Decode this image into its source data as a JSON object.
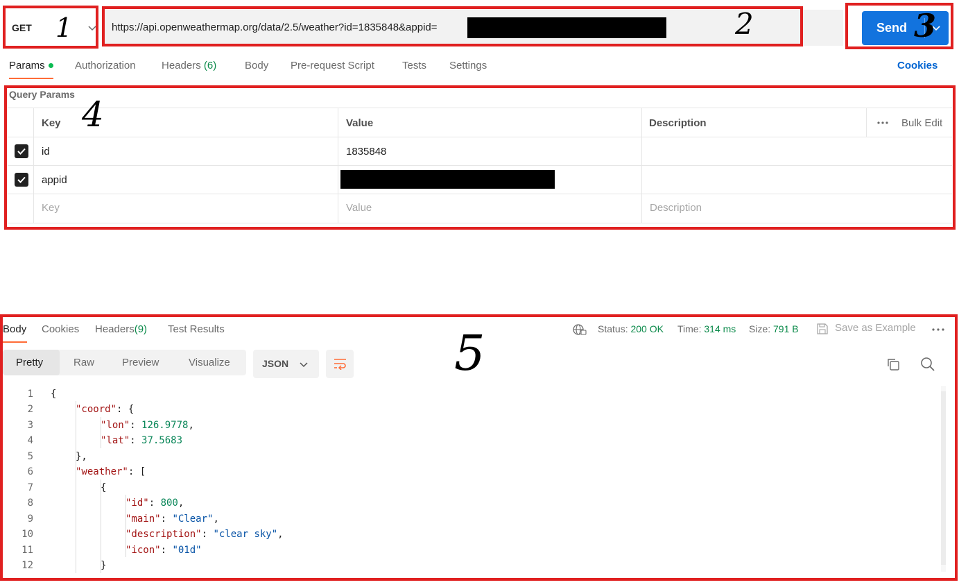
{
  "request": {
    "method": "GET",
    "url": "https://api.openweathermap.org/data/2.5/weather?id=1835848&appid=",
    "send_label": "Send"
  },
  "request_tabs": [
    {
      "label": "Params",
      "active": true
    },
    {
      "label": "Authorization"
    },
    {
      "label": "Headers",
      "count": "(6)"
    },
    {
      "label": "Body"
    },
    {
      "label": "Pre-request Script"
    },
    {
      "label": "Tests"
    },
    {
      "label": "Settings"
    }
  ],
  "cookies_link": "Cookies",
  "params": {
    "title": "Query Params",
    "headers": {
      "key": "Key",
      "value": "Value",
      "description": "Description",
      "bulk_edit": "Bulk Edit"
    },
    "rows": [
      {
        "checked": true,
        "key": "id",
        "value": "1835848"
      },
      {
        "checked": true,
        "key": "appid",
        "value": ""
      }
    ],
    "placeholders": {
      "key": "Key",
      "value": "Value",
      "description": "Description"
    }
  },
  "response": {
    "tabs": [
      {
        "label": "Body",
        "active": true
      },
      {
        "label": "Cookies"
      },
      {
        "label": "Headers",
        "count": "(9)"
      },
      {
        "label": "Test Results"
      }
    ],
    "status_label": "Status:",
    "status_value": "200 OK",
    "time_label": "Time:",
    "time_value": "314 ms",
    "size_label": "Size:",
    "size_value": "791 B",
    "save_as_example": "Save as Example",
    "view_modes": [
      "Pretty",
      "Raw",
      "Preview",
      "Visualize"
    ],
    "format": "JSON",
    "line_numbers": [
      "1",
      "2",
      "3",
      "4",
      "5",
      "6",
      "7",
      "8",
      "9",
      "10",
      "11",
      "12"
    ],
    "code": {
      "l1": "{",
      "l2_key": "\"coord\"",
      "l2_rest": ": {",
      "l3_key": "\"lon\"",
      "l3_sep": ": ",
      "l3_val": "126.9778",
      "l3_end": ",",
      "l4_key": "\"lat\"",
      "l4_sep": ": ",
      "l4_val": "37.5683",
      "l5": "},",
      "l6_key": "\"weather\"",
      "l6_rest": ": [",
      "l7": "{",
      "l8_key": "\"id\"",
      "l8_sep": ": ",
      "l8_val": "800",
      "l8_end": ",",
      "l9_key": "\"main\"",
      "l9_sep": ": ",
      "l9_val": "\"Clear\"",
      "l9_end": ",",
      "l10_key": "\"description\"",
      "l10_sep": ": ",
      "l10_val": "\"clear sky\"",
      "l10_end": ",",
      "l11_key": "\"icon\"",
      "l11_sep": ": ",
      "l11_val": "\"01d\"",
      "l12": "}"
    }
  },
  "annotations": [
    "1",
    "2",
    "3",
    "4",
    "5"
  ],
  "colors": {
    "accent": "#1273de",
    "annotation": "#e02020",
    "tab_underline": "#ff6c37",
    "status_green": "#0b8a4a"
  }
}
